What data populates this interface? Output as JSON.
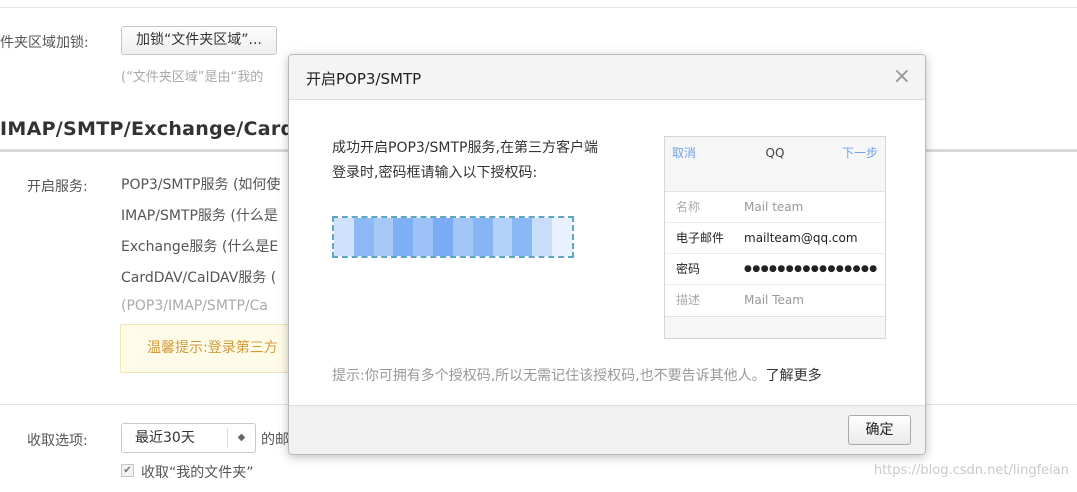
{
  "page": {
    "folder_lock": {
      "label": "件夹区域加锁:",
      "button": "加锁“文件夹区域”...",
      "hint": "(“文件夹区域”是由“我的"
    },
    "section_title": "IMAP/SMTP/Exchange/Card",
    "services": {
      "label": "开启服务:",
      "items": [
        "POP3/SMTP服务 (如何使",
        "IMAP/SMTP服务 (什么是",
        "Exchange服务 (什么是E",
        "CardDAV/CalDAV服务 ("
      ],
      "note": "(POP3/IMAP/SMTP/Ca",
      "warning": "温馨提示:登录第三方"
    },
    "receive": {
      "label": "收取选项:",
      "select_value": "最近30天",
      "select_arrow": "◆",
      "suffix": "的邮",
      "checkbox_mark": "✔",
      "checkbox_label": "收取“我的文件夹”"
    }
  },
  "modal": {
    "title": "开启POP3/SMTP",
    "close": "×",
    "desc_line1": "成功开启POP3/SMTP服务,在第三方客户端",
    "desc_line2": "登录时,密码框请输入以下授权码:",
    "code_colors": [
      "#cfe1fb",
      "#8cb8f5",
      "#a7c9f8",
      "#7fb0f4",
      "#9cc2f7",
      "#7aabf3",
      "#a2c6f7",
      "#86b4f4",
      "#b4d1f9",
      "#8ab7f5",
      "#c9ddfb",
      "#e8f1fd"
    ],
    "phone": {
      "cancel": "取消",
      "title": "QQ",
      "next": "下一步",
      "rows": [
        {
          "key": "名称",
          "value": "Mail team"
        },
        {
          "key": "电子邮件",
          "value": "mailteam@qq.com"
        },
        {
          "key": "密码",
          "value": "●●●●●●●●●●●●●●●●"
        },
        {
          "key": "描述",
          "value": "Mail Team"
        }
      ]
    },
    "tip": "提示:你可拥有多个授权码,所以无需记住该授权码,也不要告诉其他人。",
    "tip_link": "了解更多",
    "ok": "确定"
  },
  "watermark": "https://blog.csdn.net/lingfeian"
}
